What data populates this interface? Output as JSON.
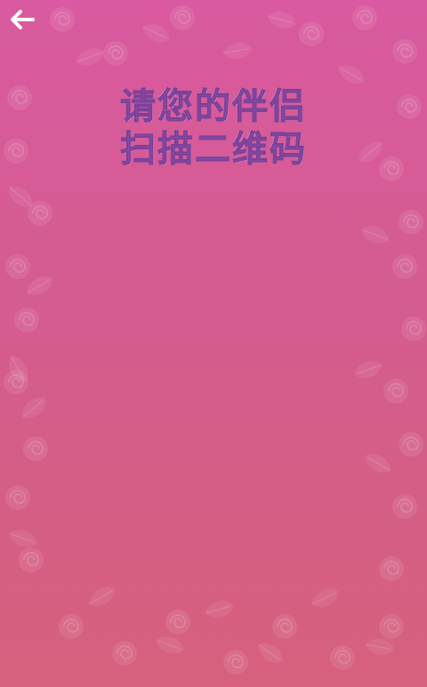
{
  "header": {
    "back_icon": "arrow-left-icon"
  },
  "prompt": {
    "line1": "请您的伴侣",
    "line2": "扫描二维码"
  },
  "colors": {
    "background_top": "#d95aa0",
    "background_bottom": "#d6607d",
    "title_text": "#8a4ea6",
    "icon": "#ffffff"
  }
}
